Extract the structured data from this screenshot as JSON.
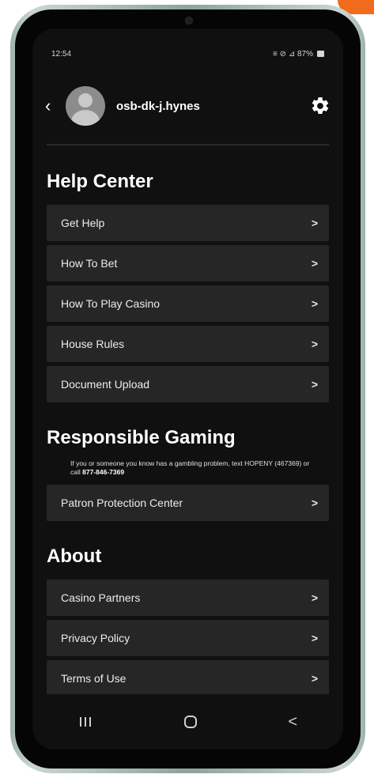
{
  "status_bar": {
    "time": "12:54",
    "indicators": "≡ ⊘ ⊿ 87%"
  },
  "header": {
    "username": "osb-dk-j.hynes",
    "back_icon": "chevron-left-icon",
    "settings_icon": "gear-icon"
  },
  "help_center": {
    "title": "Help Center",
    "items": [
      {
        "label": "Get Help"
      },
      {
        "label": "How To Bet"
      },
      {
        "label": "How To Play Casino"
      },
      {
        "label": "House Rules"
      },
      {
        "label": "Document Upload"
      }
    ]
  },
  "responsible_gaming": {
    "title": "Responsible Gaming",
    "notice": "If you or someone you know has a gambling problem, text HOPENY (467369) or call",
    "phone": "877-846-7369",
    "items": [
      {
        "label": "Patron Protection Center"
      }
    ]
  },
  "about": {
    "title": "About",
    "items": [
      {
        "label": "Casino Partners"
      },
      {
        "label": "Privacy Policy"
      },
      {
        "label": "Terms of Use"
      }
    ]
  },
  "chevron": ">",
  "nav": {
    "back_glyph": "<"
  },
  "colors": {
    "screen_background": "#101010",
    "row_background": "#262626",
    "accent": "#f26b1d",
    "phone_frame": "#a7b8b3"
  }
}
